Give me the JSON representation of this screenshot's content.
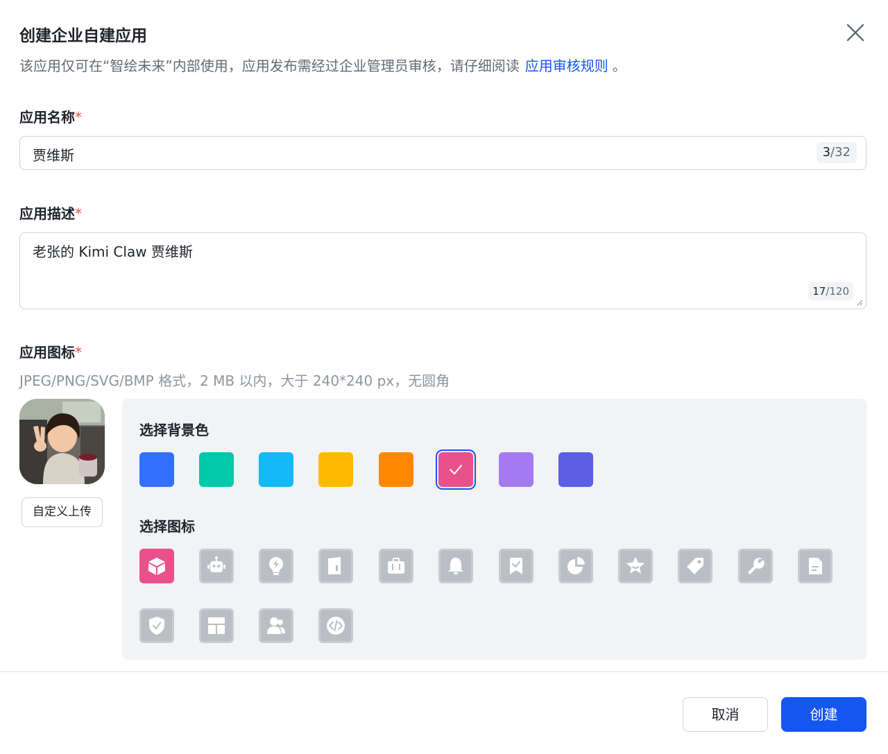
{
  "dialog": {
    "title": "创建企业自建应用",
    "notice_text": "该应用仅可在“智绘未来”内部使用，应用发布需经过企业管理员审核，请仔细阅读",
    "notice_link": "应用审核规则",
    "notice_tail": "。",
    "close_icon": "close-icon"
  },
  "fields": {
    "name": {
      "label": "应用名称",
      "required_mark": "*",
      "value": "贾维斯",
      "count": "3",
      "max": "/32"
    },
    "description": {
      "label": "应用描述",
      "required_mark": "*",
      "value": "老张的 Kimi Claw 贾维斯",
      "count": "17",
      "max": "/120"
    },
    "icon": {
      "label": "应用图标",
      "required_mark": "*",
      "hint": "JPEG/PNG/SVG/BMP 格式，2 MB 以内，大于 240*240 px，无圆角",
      "upload_label": "自定义上传"
    }
  },
  "picker": {
    "bg_title": "选择背景色",
    "bg_colors": [
      "#3370ff",
      "#00c8a9",
      "#14b9f7",
      "#ffba00",
      "#ff8800",
      "#e9518b",
      "#a57af0",
      "#5b5fe3"
    ],
    "selected_color_index": 5,
    "icon_title": "选择图标",
    "icons": [
      "cube-icon",
      "robot-icon",
      "lightbulb-icon",
      "book-icon",
      "briefcase-icon",
      "bell-icon",
      "bookmark-check-icon",
      "pie-chart-icon",
      "star-icon",
      "tag-icon",
      "wrench-icon",
      "document-icon",
      "shield-check-icon",
      "layout-icon",
      "users-icon",
      "code-icon"
    ],
    "selected_icon_index": 0
  },
  "footer": {
    "cancel_label": "取消",
    "create_label": "创建"
  }
}
